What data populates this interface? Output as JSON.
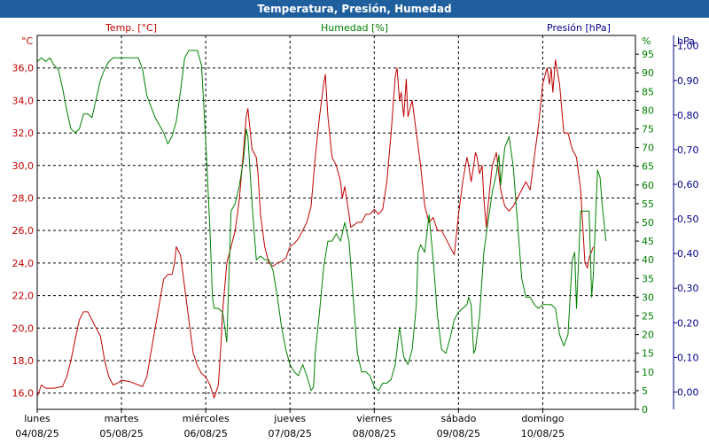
{
  "title": "Temperatura, Presión, Humedad",
  "chart_data": {
    "type": "line",
    "title": "Temperatura, Presión, Humedad",
    "temp_axis": {
      "label": "Temp. [°C]",
      "unit": "°C",
      "range": [
        15,
        38
      ],
      "ticks": [
        "16,0",
        "18,0",
        "20,0",
        "22,0",
        "24,0",
        "26,0",
        "28,0",
        "30,0",
        "32,0",
        "34,0",
        "36,0"
      ],
      "color": "#c00000"
    },
    "hum_axis": {
      "label": "Humedad [%]",
      "unit": "%",
      "range": [
        0,
        100
      ],
      "ticks": [
        "0",
        "5",
        "10",
        "15",
        "20",
        "25",
        "30",
        "35",
        "40",
        "45",
        "50",
        "55",
        "60",
        "65",
        "70",
        "75",
        "80",
        "85",
        "90",
        "95"
      ],
      "color": "#008000"
    },
    "pres_axis": {
      "label": "Presión [hPa]",
      "unit": "hPa",
      "range": [
        -0.05,
        1.03
      ],
      "ticks": [
        "0,00",
        "0,10",
        "0,20",
        "0,30",
        "0,40",
        "0,50",
        "0,60",
        "0,70",
        "0,80",
        "0,90",
        "1,00"
      ],
      "color": "#00008b"
    },
    "x_range": [
      0,
      7.1
    ],
    "x_ticks": [
      {
        "day": "lunes",
        "date": "04/08/25"
      },
      {
        "day": "martes",
        "date": "05/08/25"
      },
      {
        "day": "miércoles",
        "date": "06/08/25"
      },
      {
        "day": "jueves",
        "date": "07/08/25"
      },
      {
        "day": "viernes",
        "date": "08/08/25"
      },
      {
        "day": "sábado",
        "date": "09/08/25"
      },
      {
        "day": "domingo",
        "date": "10/08/25"
      }
    ],
    "grid": true,
    "series": [
      {
        "name": "Temp. [°C]",
        "axis": "temp",
        "color": "#c00000",
        "points": [
          [
            0.0,
            15.8
          ],
          [
            0.05,
            16.5
          ],
          [
            0.1,
            16.3
          ],
          [
            0.2,
            16.3
          ],
          [
            0.3,
            16.4
          ],
          [
            0.35,
            17.0
          ],
          [
            0.4,
            18.0
          ],
          [
            0.45,
            19.3
          ],
          [
            0.5,
            20.5
          ],
          [
            0.55,
            21.0
          ],
          [
            0.6,
            21.0
          ],
          [
            0.7,
            20.0
          ],
          [
            0.75,
            19.5
          ],
          [
            0.8,
            18.0
          ],
          [
            0.85,
            17.0
          ],
          [
            0.9,
            16.5
          ],
          [
            0.95,
            16.6
          ],
          [
            1.0,
            16.8
          ],
          [
            1.1,
            16.7
          ],
          [
            1.2,
            16.5
          ],
          [
            1.25,
            16.4
          ],
          [
            1.3,
            17.0
          ],
          [
            1.35,
            18.5
          ],
          [
            1.4,
            20.0
          ],
          [
            1.45,
            21.5
          ],
          [
            1.5,
            23.0
          ],
          [
            1.55,
            23.3
          ],
          [
            1.6,
            23.3
          ],
          [
            1.63,
            24.0
          ],
          [
            1.65,
            25.0
          ],
          [
            1.7,
            24.5
          ],
          [
            1.75,
            22.5
          ],
          [
            1.8,
            20.5
          ],
          [
            1.85,
            18.5
          ],
          [
            1.9,
            17.7
          ],
          [
            1.95,
            17.2
          ],
          [
            2.0,
            17.0
          ],
          [
            2.05,
            16.5
          ],
          [
            2.1,
            15.7
          ],
          [
            2.15,
            16.5
          ],
          [
            2.18,
            19.0
          ],
          [
            2.2,
            21.0
          ],
          [
            2.25,
            24.0
          ],
          [
            2.3,
            25.0
          ],
          [
            2.35,
            26.0
          ],
          [
            2.4,
            28.0
          ],
          [
            2.45,
            31.0
          ],
          [
            2.48,
            33.0
          ],
          [
            2.5,
            33.5
          ],
          [
            2.55,
            31.0
          ],
          [
            2.6,
            30.5
          ],
          [
            2.62,
            29.5
          ],
          [
            2.65,
            27.0
          ],
          [
            2.7,
            25.0
          ],
          [
            2.75,
            24.0
          ],
          [
            2.8,
            23.8
          ],
          [
            2.85,
            24.0
          ],
          [
            2.9,
            24.1
          ],
          [
            2.95,
            24.3
          ],
          [
            3.0,
            25.0
          ],
          [
            3.05,
            25.2
          ],
          [
            3.1,
            25.5
          ],
          [
            3.15,
            26.0
          ],
          [
            3.2,
            26.5
          ],
          [
            3.25,
            27.5
          ],
          [
            3.3,
            30.5
          ],
          [
            3.35,
            33.0
          ],
          [
            3.4,
            35.0
          ],
          [
            3.42,
            35.6
          ],
          [
            3.45,
            33.0
          ],
          [
            3.5,
            30.5
          ],
          [
            3.55,
            30.0
          ],
          [
            3.6,
            29.0
          ],
          [
            3.62,
            28.0
          ],
          [
            3.65,
            28.7
          ],
          [
            3.7,
            27.0
          ],
          [
            3.72,
            26.2
          ],
          [
            3.75,
            26.3
          ],
          [
            3.8,
            26.5
          ],
          [
            3.85,
            26.5
          ],
          [
            3.9,
            27.0
          ],
          [
            3.95,
            27.0
          ],
          [
            4.0,
            27.3
          ],
          [
            4.05,
            27.0
          ],
          [
            4.1,
            27.3
          ],
          [
            4.15,
            29.0
          ],
          [
            4.2,
            32.0
          ],
          [
            4.25,
            35.5
          ],
          [
            4.27,
            36.0
          ],
          [
            4.3,
            34.0
          ],
          [
            4.32,
            34.5
          ],
          [
            4.35,
            33.0
          ],
          [
            4.38,
            35.3
          ],
          [
            4.4,
            33.0
          ],
          [
            4.45,
            34.0
          ],
          [
            4.5,
            32.0
          ],
          [
            4.55,
            30.0
          ],
          [
            4.6,
            27.5
          ],
          [
            4.65,
            26.5
          ],
          [
            4.7,
            26.8
          ],
          [
            4.75,
            26.0
          ],
          [
            4.8,
            26.0
          ],
          [
            4.85,
            25.5
          ],
          [
            4.9,
            25.0
          ],
          [
            4.95,
            24.5
          ],
          [
            5.0,
            27.0
          ],
          [
            5.05,
            29.0
          ],
          [
            5.1,
            30.5
          ],
          [
            5.12,
            30.0
          ],
          [
            5.15,
            29.0
          ],
          [
            5.18,
            30.0
          ],
          [
            5.2,
            30.8
          ],
          [
            5.22,
            30.5
          ],
          [
            5.25,
            29.5
          ],
          [
            5.28,
            30.0
          ],
          [
            5.3,
            28.0
          ],
          [
            5.33,
            26.2
          ],
          [
            5.35,
            27.5
          ],
          [
            5.4,
            30.0
          ],
          [
            5.45,
            30.8
          ],
          [
            5.5,
            28.5
          ],
          [
            5.55,
            27.5
          ],
          [
            5.6,
            27.2
          ],
          [
            5.65,
            27.5
          ],
          [
            5.7,
            28.0
          ],
          [
            5.8,
            29.0
          ],
          [
            5.85,
            28.5
          ],
          [
            5.9,
            30.5
          ],
          [
            5.95,
            32.5
          ],
          [
            6.0,
            35.0
          ],
          [
            6.05,
            36.0
          ],
          [
            6.08,
            35.0
          ],
          [
            6.1,
            36.0
          ],
          [
            6.12,
            34.5
          ],
          [
            6.15,
            36.5
          ],
          [
            6.2,
            35.0
          ],
          [
            6.25,
            32.0
          ],
          [
            6.3,
            32.0
          ],
          [
            6.35,
            31.0
          ],
          [
            6.4,
            30.5
          ],
          [
            6.45,
            28.5
          ],
          [
            6.5,
            24.0
          ],
          [
            6.53,
            23.7
          ],
          [
            6.55,
            24.3
          ],
          [
            6.6,
            25.0
          ]
        ]
      },
      {
        "name": "Humedad [%]",
        "axis": "hum",
        "color": "#008000",
        "points": [
          [
            0.0,
            93
          ],
          [
            0.05,
            94
          ],
          [
            0.1,
            93
          ],
          [
            0.15,
            94
          ],
          [
            0.2,
            92
          ],
          [
            0.25,
            91
          ],
          [
            0.3,
            86
          ],
          [
            0.35,
            80
          ],
          [
            0.4,
            75
          ],
          [
            0.45,
            74
          ],
          [
            0.5,
            75
          ],
          [
            0.55,
            79
          ],
          [
            0.6,
            79
          ],
          [
            0.65,
            78
          ],
          [
            0.7,
            83
          ],
          [
            0.75,
            88
          ],
          [
            0.8,
            91
          ],
          [
            0.85,
            93
          ],
          [
            0.9,
            94
          ],
          [
            0.95,
            94
          ],
          [
            1.0,
            94
          ],
          [
            1.1,
            94
          ],
          [
            1.2,
            94
          ],
          [
            1.25,
            91
          ],
          [
            1.3,
            84
          ],
          [
            1.35,
            81
          ],
          [
            1.4,
            78
          ],
          [
            1.45,
            76
          ],
          [
            1.5,
            74
          ],
          [
            1.55,
            71
          ],
          [
            1.6,
            73
          ],
          [
            1.65,
            77
          ],
          [
            1.7,
            85
          ],
          [
            1.75,
            94
          ],
          [
            1.8,
            96
          ],
          [
            1.85,
            96
          ],
          [
            1.9,
            96
          ],
          [
            1.95,
            92
          ],
          [
            2.0,
            72
          ],
          [
            2.05,
            48
          ],
          [
            2.08,
            30
          ],
          [
            2.1,
            27
          ],
          [
            2.15,
            27
          ],
          [
            2.2,
            26
          ],
          [
            2.25,
            18
          ],
          [
            2.3,
            53
          ],
          [
            2.35,
            55
          ],
          [
            2.4,
            60
          ],
          [
            2.45,
            67
          ],
          [
            2.48,
            75
          ],
          [
            2.5,
            73
          ],
          [
            2.55,
            55
          ],
          [
            2.6,
            40
          ],
          [
            2.65,
            41
          ],
          [
            2.7,
            40
          ],
          [
            2.75,
            40
          ],
          [
            2.8,
            37
          ],
          [
            2.85,
            30
          ],
          [
            2.9,
            22
          ],
          [
            2.95,
            16
          ],
          [
            3.0,
            12
          ],
          [
            3.05,
            10
          ],
          [
            3.1,
            9
          ],
          [
            3.15,
            12
          ],
          [
            3.2,
            9
          ],
          [
            3.25,
            5
          ],
          [
            3.28,
            6
          ],
          [
            3.3,
            15
          ],
          [
            3.35,
            26
          ],
          [
            3.4,
            38
          ],
          [
            3.45,
            45
          ],
          [
            3.5,
            45
          ],
          [
            3.55,
            47
          ],
          [
            3.6,
            45
          ],
          [
            3.65,
            50
          ],
          [
            3.7,
            45
          ],
          [
            3.75,
            30
          ],
          [
            3.8,
            15
          ],
          [
            3.85,
            10
          ],
          [
            3.9,
            10
          ],
          [
            3.95,
            9
          ],
          [
            4.0,
            6
          ],
          [
            4.05,
            5
          ],
          [
            4.1,
            7
          ],
          [
            4.15,
            7
          ],
          [
            4.2,
            8
          ],
          [
            4.25,
            12
          ],
          [
            4.3,
            22
          ],
          [
            4.35,
            14
          ],
          [
            4.4,
            12
          ],
          [
            4.45,
            16
          ],
          [
            4.5,
            28
          ],
          [
            4.52,
            42
          ],
          [
            4.55,
            44
          ],
          [
            4.6,
            42
          ],
          [
            4.65,
            52
          ],
          [
            4.7,
            40
          ],
          [
            4.75,
            25
          ],
          [
            4.8,
            16
          ],
          [
            4.85,
            15
          ],
          [
            4.9,
            19
          ],
          [
            4.95,
            24
          ],
          [
            5.0,
            26
          ],
          [
            5.05,
            27
          ],
          [
            5.1,
            28
          ],
          [
            5.12,
            30
          ],
          [
            5.15,
            28
          ],
          [
            5.18,
            15
          ],
          [
            5.2,
            16
          ],
          [
            5.25,
            25
          ],
          [
            5.3,
            42
          ],
          [
            5.35,
            50
          ],
          [
            5.4,
            58
          ],
          [
            5.45,
            63
          ],
          [
            5.48,
            68
          ],
          [
            5.5,
            60
          ],
          [
            5.55,
            70
          ],
          [
            5.6,
            73
          ],
          [
            5.65,
            65
          ],
          [
            5.7,
            50
          ],
          [
            5.75,
            35
          ],
          [
            5.8,
            30
          ],
          [
            5.85,
            30
          ],
          [
            5.9,
            28
          ],
          [
            5.95,
            27
          ],
          [
            6.0,
            28
          ],
          [
            6.05,
            28
          ],
          [
            6.1,
            28
          ],
          [
            6.15,
            27
          ],
          [
            6.2,
            20
          ],
          [
            6.25,
            17
          ],
          [
            6.3,
            20
          ],
          [
            6.35,
            40
          ],
          [
            6.38,
            42
          ],
          [
            6.4,
            27
          ],
          [
            6.45,
            53
          ],
          [
            6.5,
            53
          ],
          [
            6.55,
            53
          ],
          [
            6.58,
            30
          ],
          [
            6.6,
            36
          ],
          [
            6.65,
            64
          ],
          [
            6.68,
            62
          ],
          [
            6.7,
            56
          ],
          [
            6.75,
            45
          ]
        ]
      }
    ]
  }
}
